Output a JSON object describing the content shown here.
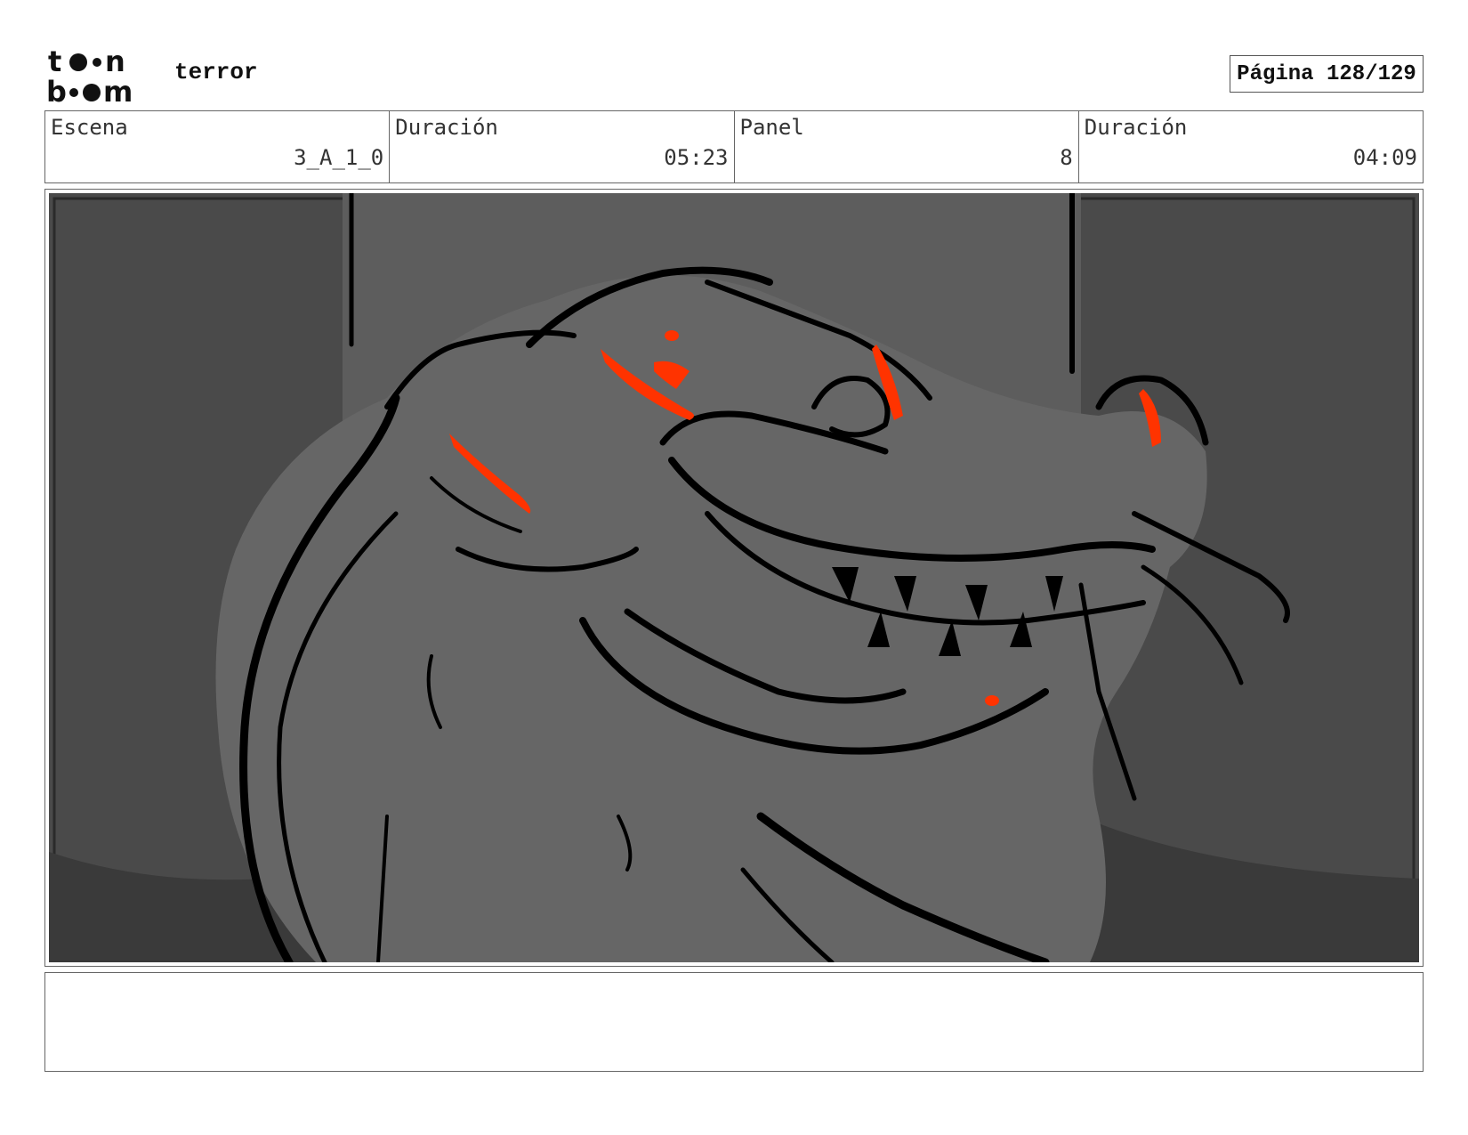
{
  "header": {
    "brand_top": "to n",
    "brand_bottom": "b m",
    "project_title": "terror",
    "page_label": "Página 128/129"
  },
  "info": {
    "scene_label": "Escena",
    "scene_value": "3_A_1_0",
    "scene_duration_label": "Duración",
    "scene_duration_value": "05:23",
    "panel_label": "Panel",
    "panel_value": "8",
    "panel_duration_label": "Duración",
    "panel_duration_value": "04:09"
  },
  "panel": {
    "image_subject": "dragon-head-sketch",
    "colors": {
      "background": "#4a4a4a",
      "mid": "#666666",
      "lines": "#000000",
      "accent": "#ff3300"
    }
  },
  "notes": {
    "text": ""
  }
}
